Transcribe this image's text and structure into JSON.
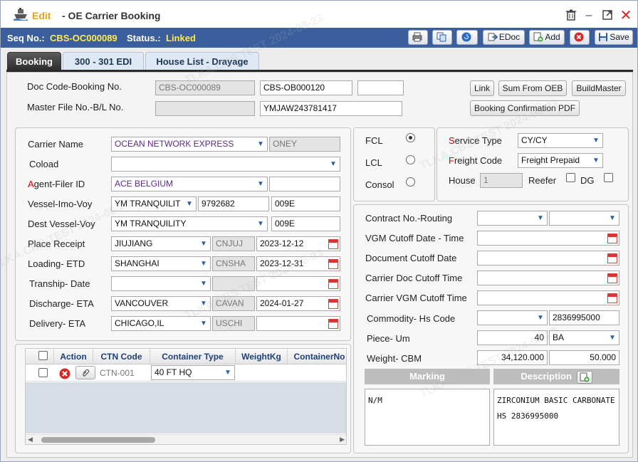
{
  "window": {
    "edit_label": "Edit",
    "title": "- OE Carrier Booking"
  },
  "seqbar": {
    "seq_label": "Seq No.:",
    "seq_value": "CBS-OC000089",
    "status_label": "Status.:",
    "status_value": "Linked"
  },
  "toolbar": {
    "edoc_label": "EDoc",
    "add_label": "Add",
    "save_label": "Save"
  },
  "tabs": [
    {
      "label": "Booking"
    },
    {
      "label": "300 - 301 EDI"
    },
    {
      "label": "House List - Drayage"
    }
  ],
  "header": {
    "doc_code_label": "Doc Code-Booking No.",
    "doc_code_value": "CBS-OC000089",
    "booking_no_value": "CBS-OB000120",
    "extra_value": "",
    "master_label": "Master File No.-B/L No.",
    "master_value": "",
    "bl_no_value": "YMJAW243781417",
    "link_label": "Link",
    "sum_label": "Sum From OEB",
    "build_label": "BuildMaster",
    "confirm_label": "Booking Confirmation PDF"
  },
  "left": {
    "carrier_label": "Carrier Name",
    "carrier_value": "OCEAN NETWORK EXPRESS",
    "carrier_code": "ONEY",
    "coload_label": "Coload",
    "coload_value": "",
    "agent_label_a": "A",
    "agent_label_rest": "gent-Filer ID",
    "agent_value": "ACE BELGIUM",
    "agent_code": "",
    "vessel_label": "Vessel-Imo-Voy",
    "vessel_value": "YM TRANQUILIT",
    "imo_value": "9792682",
    "voy_value": "009E",
    "dest_vessel_label": "Dest Vessel-Voy",
    "dest_vessel_value": "YM TRANQUILITY",
    "dest_voy_value": "009E",
    "place_label": "Place Receipt",
    "place_value": "JIUJIANG",
    "place_code": "CNJUJ",
    "place_date": "2023-12-12",
    "loading_label": "Loading- ETD",
    "loading_value": "SHANGHAI",
    "loading_code": "CNSHA",
    "loading_date": "2023-12-31",
    "tranship_label": "Tranship- Date",
    "tranship_value": "",
    "tranship_code": "",
    "tranship_date": "",
    "discharge_label": "Discharge- ETA",
    "discharge_value": "VANCOUVER",
    "discharge_code": "CAVAN",
    "discharge_date": "2024-01-27",
    "delivery_label": "Delivery- ETA",
    "delivery_value": "CHICAGO,IL",
    "delivery_code": "USCHI",
    "delivery_date": ""
  },
  "mode": {
    "fcl_label": "FCL",
    "lcl_label": "LCL",
    "consol_label": "Consol",
    "selected": "FCL"
  },
  "service": {
    "service_label_s": "S",
    "service_label_rest": "ervice Type",
    "service_value": "CY/CY",
    "freight_label_f": "F",
    "freight_label_rest": "reight Code",
    "freight_value": "Freight Prepaid",
    "house_label": "House",
    "house_value": "1",
    "reefer_label": "Reefer",
    "dg_label": "DG"
  },
  "right": {
    "contract_label": "Contract No.-Routing",
    "contract_value": "",
    "routing_value": "",
    "vgm_label": "VGM Cutoff Date - Time",
    "vgm_value": "",
    "doc_cutoff_label": "Document Cutoff Date",
    "doc_cutoff_value": "",
    "carrier_doc_label": "Carrier Doc Cutoff Time",
    "carrier_doc_value": "",
    "carrier_vgm_label": "Carrier VGM Cutoff Time",
    "carrier_vgm_value": "",
    "commodity_label": "Commodity- Hs Code",
    "commodity_value": "",
    "hs_value": "2836995000",
    "piece_label": "Piece- Um",
    "piece_value": "40",
    "um_value": "BA",
    "weight_label": "Weight- CBM",
    "weight_value": "34,120.000",
    "cbm_value": "50.000",
    "marking_label": "Marking",
    "description_label": "Description",
    "marking_text": "N/M",
    "description_line1": "ZIRCONIUM BASIC CARBONATE",
    "description_line2": "HS 2836995000"
  },
  "grid": {
    "columns": [
      "Action",
      "CTN Code",
      "Container Type",
      "WeightKg",
      "ContainerNo"
    ],
    "rows": [
      {
        "ctn_code": "CTN-001",
        "container_type": "40 FT HQ",
        "weight": "",
        "container_no": ""
      }
    ]
  },
  "watermark": "TLKA.CBS.TEST 2024-08-23",
  "colors": {
    "accent": "#3b5f9c",
    "status": "#ffe94f",
    "edit": "#e8a317"
  }
}
